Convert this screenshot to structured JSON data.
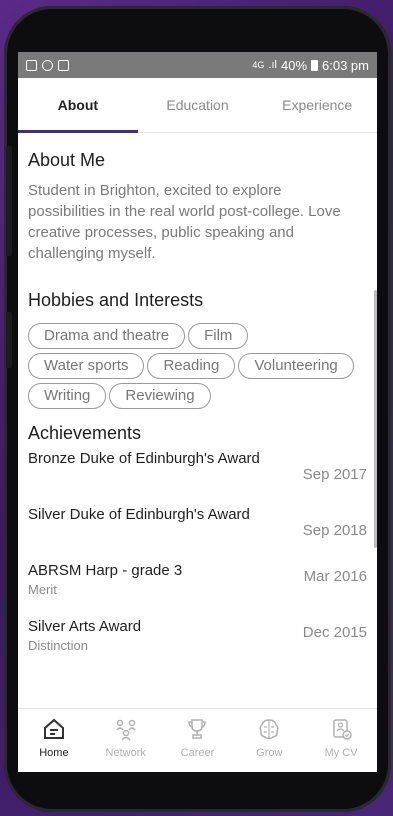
{
  "status_bar": {
    "network": "4G",
    "battery": "40%",
    "time": "6:03 pm"
  },
  "tabs": [
    {
      "label": "About",
      "active": true
    },
    {
      "label": "Education",
      "active": false
    },
    {
      "label": "Experience",
      "active": false
    }
  ],
  "about": {
    "heading": "About Me",
    "text": "Student in Brighton, excited to explore possibilities in the real world post-college. Love creative processes, public speaking and challenging myself."
  },
  "hobbies": {
    "heading": "Hobbies and Interests",
    "tags": [
      "Drama and theatre",
      "Film",
      "Water sports",
      "Reading",
      "Volunteering",
      "Writing",
      "Reviewing"
    ]
  },
  "achievements": {
    "heading": "Achievements",
    "items": [
      {
        "title": "Bronze Duke of Edinburgh's Award",
        "subtitle": "",
        "date": "Sep 2017"
      },
      {
        "title": "Silver Duke of Edinburgh's Award",
        "subtitle": "",
        "date": "Sep 2018"
      },
      {
        "title": "ABRSM Harp - grade 3",
        "subtitle": "Merit",
        "date": "Mar 2016"
      },
      {
        "title": "Silver Arts Award",
        "subtitle": "Distinction",
        "date": "Dec 2015"
      }
    ]
  },
  "bottom_nav": [
    {
      "label": "Home",
      "icon": "home-icon",
      "active": true
    },
    {
      "label": "Network",
      "icon": "network-icon",
      "active": false
    },
    {
      "label": "Career",
      "icon": "trophy-icon",
      "active": false
    },
    {
      "label": "Grow",
      "icon": "brain-icon",
      "active": false
    },
    {
      "label": "My CV",
      "icon": "cv-icon",
      "active": false
    }
  ],
  "colors": {
    "accent": "#4b2a7b",
    "background": "#4a2676"
  }
}
